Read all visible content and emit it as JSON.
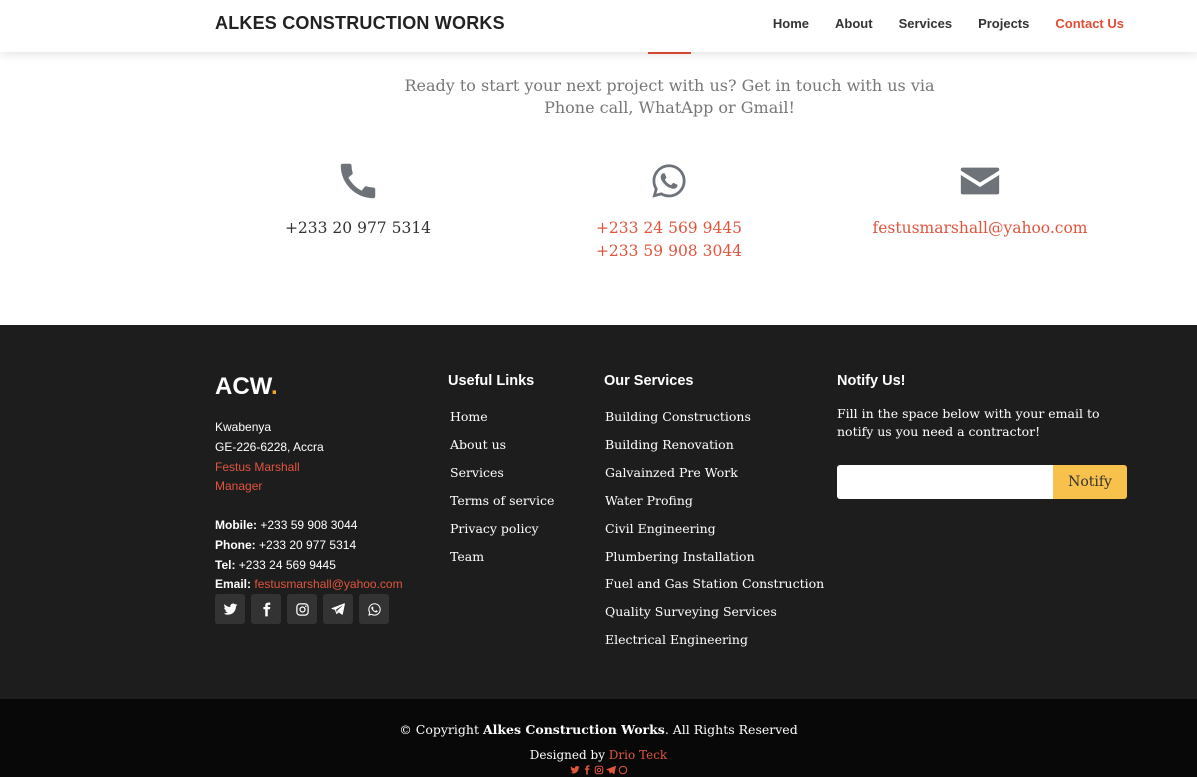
{
  "header": {
    "brand": "ALKES CONSTRUCTION WORKS",
    "nav": [
      "Home",
      "About",
      "Services",
      "Projects",
      "Contact Us"
    ],
    "active_nav": "Contact Us"
  },
  "contact": {
    "intro": "Ready to start your next project with us? Get in touch with us via Phone call, WhatApp or Gmail!",
    "phone": {
      "icon": "phone-icon",
      "number": "+233 20 977 5314"
    },
    "whatsapp": {
      "icon": "whatsapp-icon",
      "numbers": [
        "+233 24 569 9445",
        "+233 59 908 3044"
      ]
    },
    "email": {
      "icon": "envelope-icon",
      "address": "festusmarshall@yahoo.com"
    }
  },
  "footer": {
    "logo": "ACW",
    "logo_dot": ".",
    "address": [
      "Kwabenya",
      "GE-226-6228, Accra"
    ],
    "contact_person": "Festus Marshall",
    "contact_role": "Manager",
    "mobile_label": "Mobile:",
    "mobile": "+233 59 908 3044",
    "phone_label": "Phone:",
    "phone": "+233 20 977 5314",
    "tel_label": "Tel:",
    "tel": "+233 24 569 9445",
    "email_label": "Email:",
    "email": "festusmarshall@yahoo.com",
    "social_icons": [
      "twitter-icon",
      "facebook-icon",
      "instagram-icon",
      "telegram-icon",
      "whatsapp-icon"
    ],
    "useful_links_title": "Useful Links",
    "useful_links": [
      "Home",
      "About us",
      "Services",
      "Terms of service",
      "Privacy policy",
      "Team"
    ],
    "services_title": "Our Services",
    "services": [
      "Building Constructions",
      "Building Renovation",
      "Galvainzed Pre Work",
      "Water Profing",
      "Civil Engineering",
      "Plumbering Installation",
      "Fuel and Gas Station Construction",
      "Quality Surveying Services",
      "Electrical Engineering"
    ],
    "notify_title": "Notify Us!",
    "notify_text": "Fill in the space below with your email to notify us you need a contractor!",
    "notify_input_value": "",
    "notify_button": "Notify"
  },
  "bottom": {
    "copyright_symbol": "©",
    "copyright_pre": "Copyright",
    "company": "Alkes Construction Works",
    "copyright_post": ". All Rights Reserved",
    "designed_by_label": "Designed by",
    "designer": "Drio Teck"
  },
  "colors": {
    "accent": "#e24c36",
    "footer_bg": "#1d1d1d",
    "notify_button": "#f8c14b",
    "logo_dot": "#f5a623"
  }
}
